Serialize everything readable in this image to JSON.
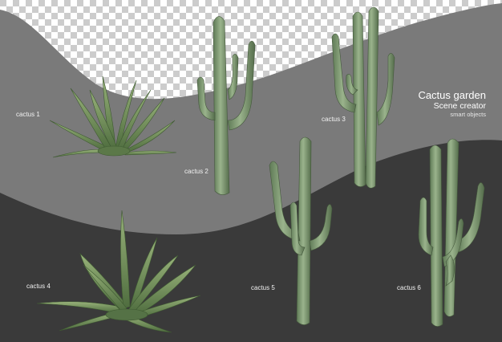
{
  "title": {
    "main": "Cactus garden",
    "sub": "Scene creator",
    "small": "smart objects"
  },
  "labels": {
    "cactus_1": "cactus 1",
    "cactus_2": "cactus 2",
    "cactus_3": "cactus 3",
    "cactus_4": "cactus 4",
    "cactus_5": "cactus 5",
    "cactus_6": "cactus 6"
  },
  "colors": {
    "checker_light": "#ffffff",
    "checker_dark": "#cccccc",
    "band_mid": "#7a7a7a",
    "band_dark": "#3a3a3a",
    "cactus_green": "#7e9a73",
    "agave_green": "#6f8f5a"
  }
}
